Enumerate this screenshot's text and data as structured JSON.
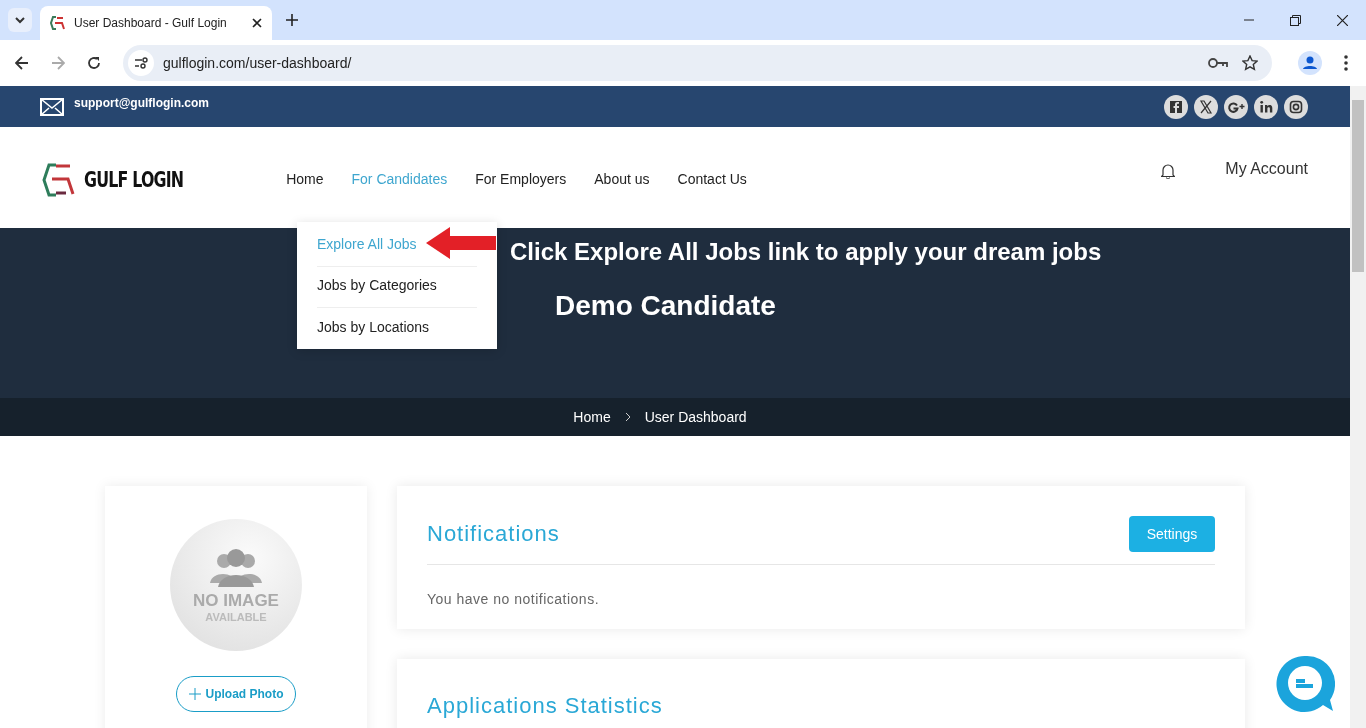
{
  "browser": {
    "tab_title": "User Dashboard - Gulf Login",
    "url": "gulflogin.com/user-dashboard/"
  },
  "top_bar": {
    "email": "support@gulflogin.com"
  },
  "header": {
    "logo_text": "GULF LOGIN",
    "account": "My Account",
    "nav": [
      {
        "label": "Home",
        "selected": false
      },
      {
        "label": "For Candidates",
        "selected": true
      },
      {
        "label": "For Employers",
        "selected": false
      },
      {
        "label": "About us",
        "selected": false
      },
      {
        "label": "Contact Us",
        "selected": false
      }
    ]
  },
  "dropdown": [
    {
      "label": "Explore All Jobs",
      "selected": true
    },
    {
      "label": "Jobs by Categories",
      "selected": false
    },
    {
      "label": "Jobs by Locations",
      "selected": false
    }
  ],
  "annotation": "Click Explore All Jobs link to apply your dream jobs",
  "hero": {
    "title": "Demo Candidate",
    "breadcrumb": [
      "Home",
      "User Dashboard"
    ]
  },
  "profile": {
    "avatar_text": [
      "NO IMAGE",
      "AVAILABLE"
    ],
    "upload": "Upload Photo"
  },
  "notifications": {
    "title": "Notifications",
    "button": "Settings",
    "message": "You have no notifications."
  },
  "statistics": {
    "title": "Applications Statistics"
  }
}
